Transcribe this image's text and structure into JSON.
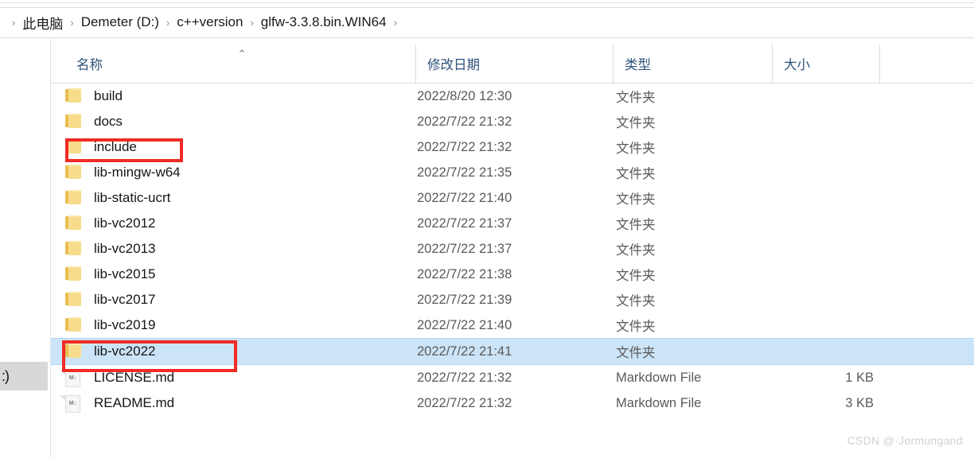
{
  "window": {
    "app": "File Explorer"
  },
  "addressbar": {
    "separator": "›",
    "crumbs": [
      {
        "label": "此电脑"
      },
      {
        "label": "Demeter (D:)"
      },
      {
        "label": "c++version"
      },
      {
        "label": "glfw-3.3.8.bin.WIN64"
      }
    ],
    "trailing_separator": "›"
  },
  "columns": {
    "name": "名称",
    "date_modified": "修改日期",
    "type": "类型",
    "size": "大小",
    "sort_caret": "⌃"
  },
  "rows": [
    {
      "name": "build",
      "date": "2022/8/20 12:30",
      "type": "文件夹",
      "size": "",
      "icon": "folder-icon",
      "selected": false
    },
    {
      "name": "docs",
      "date": "2022/7/22 21:32",
      "type": "文件夹",
      "size": "",
      "icon": "folder-icon",
      "selected": false
    },
    {
      "name": "include",
      "date": "2022/7/22 21:32",
      "type": "文件夹",
      "size": "",
      "icon": "folder-icon",
      "selected": false
    },
    {
      "name": "lib-mingw-w64",
      "date": "2022/7/22 21:35",
      "type": "文件夹",
      "size": "",
      "icon": "folder-icon",
      "selected": false
    },
    {
      "name": "lib-static-ucrt",
      "date": "2022/7/22 21:40",
      "type": "文件夹",
      "size": "",
      "icon": "folder-icon",
      "selected": false
    },
    {
      "name": "lib-vc2012",
      "date": "2022/7/22 21:37",
      "type": "文件夹",
      "size": "",
      "icon": "folder-icon",
      "selected": false
    },
    {
      "name": "lib-vc2013",
      "date": "2022/7/22 21:37",
      "type": "文件夹",
      "size": "",
      "icon": "folder-icon",
      "selected": false
    },
    {
      "name": "lib-vc2015",
      "date": "2022/7/22 21:38",
      "type": "文件夹",
      "size": "",
      "icon": "folder-icon",
      "selected": false
    },
    {
      "name": "lib-vc2017",
      "date": "2022/7/22 21:39",
      "type": "文件夹",
      "size": "",
      "icon": "folder-icon",
      "selected": false
    },
    {
      "name": "lib-vc2019",
      "date": "2022/7/22 21:40",
      "type": "文件夹",
      "size": "",
      "icon": "folder-icon",
      "selected": false
    },
    {
      "name": "lib-vc2022",
      "date": "2022/7/22 21:41",
      "type": "文件夹",
      "size": "",
      "icon": "folder-icon",
      "selected": true
    },
    {
      "name": "LICENSE.md",
      "date": "2022/7/22 21:32",
      "type": "Markdown File",
      "size": "1 KB",
      "icon": "markdown-file-icon",
      "selected": false
    },
    {
      "name": "README.md",
      "date": "2022/7/22 21:32",
      "type": "Markdown File",
      "size": "3 KB",
      "icon": "markdown-file-icon",
      "selected": false
    }
  ],
  "annotations": [
    {
      "id": "annot-include",
      "target": "include",
      "color": "#f02b25"
    },
    {
      "id": "annot-vc2022",
      "target": "lib-vc2022",
      "color": "#f02b25"
    }
  ],
  "status_chip": {
    "text": ":)"
  },
  "watermark": {
    "text": "CSDN @·Jormungand"
  },
  "md_icon_glyph": "M↓",
  "colors": {
    "selection": "#cce4f7",
    "selection_border": "#afd7f5",
    "annotation_red": "#f02b25",
    "folder_yellow": "#f7dc8b",
    "header_text": "#2d5279"
  }
}
